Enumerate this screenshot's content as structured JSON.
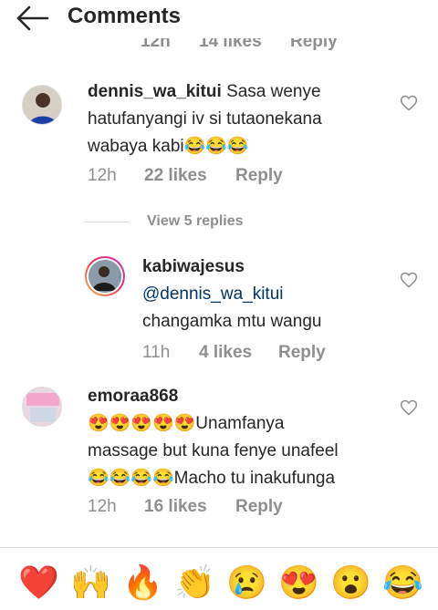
{
  "header": {
    "title": "Comments"
  },
  "cut_meta": {
    "time": "12h",
    "likes": "14 likes",
    "reply": "Reply"
  },
  "comments": [
    {
      "username": "dennis_wa_kitui",
      "text_line1": "Sasa wenye",
      "text_line2": "hatufanyangi iv si tutaonekana",
      "text_line3": "wabaya kabi😂😂😂",
      "time": "12h",
      "likes": "22 likes",
      "reply": "Reply",
      "view_replies": "View 5 replies"
    },
    {
      "username": "kabiwajesus",
      "mention": "@dennis_wa_kitui",
      "text": "changamka mtu wangu",
      "time": "11h",
      "likes": "4 likes",
      "reply": "Reply"
    },
    {
      "username": "emoraa868",
      "text_line1": "😍😍😍😍😍Unamfanya",
      "text_line2": "massage but kuna fenye unafeel",
      "text_line3": "😂😂😂😂Macho tu inakufunga",
      "time": "12h",
      "likes": "16 likes",
      "reply": "Reply"
    }
  ],
  "emoji_bar": [
    "❤️",
    "🙌",
    "🔥",
    "👏",
    "😢",
    "😍",
    "😮",
    "😂"
  ],
  "colors": {
    "text": "#262626",
    "secondary": "#8e8e8e",
    "mention": "#003569",
    "divider": "#dbdbdb"
  }
}
